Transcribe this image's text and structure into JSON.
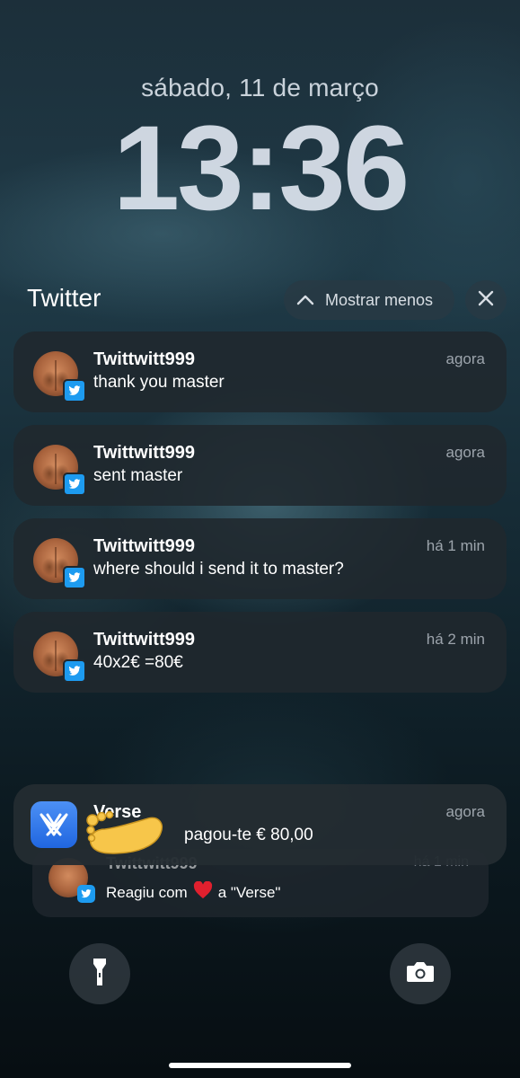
{
  "lockscreen": {
    "date": "sábado, 11 de março",
    "time": "13:36"
  },
  "group": {
    "title": "Twitter",
    "show_less_label": "Mostrar menos"
  },
  "notifications": [
    {
      "sender": "Twittwitt999",
      "message": "thank you master",
      "time": "agora"
    },
    {
      "sender": "Twittwitt999",
      "message": "sent master",
      "time": "agora"
    },
    {
      "sender": "Twittwitt999",
      "message": "where should i send it to master?",
      "time": "há 1 min"
    },
    {
      "sender": "Twittwitt999",
      "message": "40x2€ =80€",
      "time": "há 2 min"
    }
  ],
  "verse_notification": {
    "app": "Verse",
    "message": "pagou-te € 80,00",
    "time": "agora"
  },
  "stacked_notification": {
    "sender": "Twittwitt999",
    "time": "há 1 min",
    "message_prefix": "Reagiu com",
    "message_suffix": "a \"Verse\""
  },
  "colors": {
    "twitter_blue": "#1d9bf0",
    "verse_blue": "#2f7bef",
    "heart_red": "#e0202e"
  },
  "icons": {
    "show_less": "chevron-up-icon",
    "close": "close-icon",
    "flashlight": "flashlight-icon",
    "camera": "camera-icon",
    "verse": "verse-logo-icon",
    "twitter": "twitter-bird-icon",
    "reaction": "heart-icon",
    "overlay": "foot-emoji-icon"
  }
}
